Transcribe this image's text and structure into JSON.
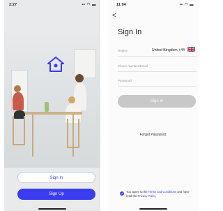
{
  "left": {
    "status": {
      "time": "2:27"
    },
    "buttons": {
      "sign_in": "Sign In",
      "sign_up": "Sign Up"
    },
    "colors": {
      "accent": "#3b3bf0"
    }
  },
  "right": {
    "status": {
      "time": "11:04"
    },
    "back": "<",
    "title": "Sign In",
    "region": {
      "label": "Region",
      "value": "United Kingdom +44",
      "flag": "uk-flag-icon"
    },
    "phone_email": {
      "placeholder": "Phone Number/Email"
    },
    "password": {
      "placeholder": "Password"
    },
    "sign_in_button": "Sign In",
    "forgot_password": "Forgot Password",
    "agreement": {
      "prefix": "You agree to the ",
      "terms": "Terms and Conditions",
      "middle": " and have read the ",
      "privacy": "Privacy Policy"
    }
  }
}
